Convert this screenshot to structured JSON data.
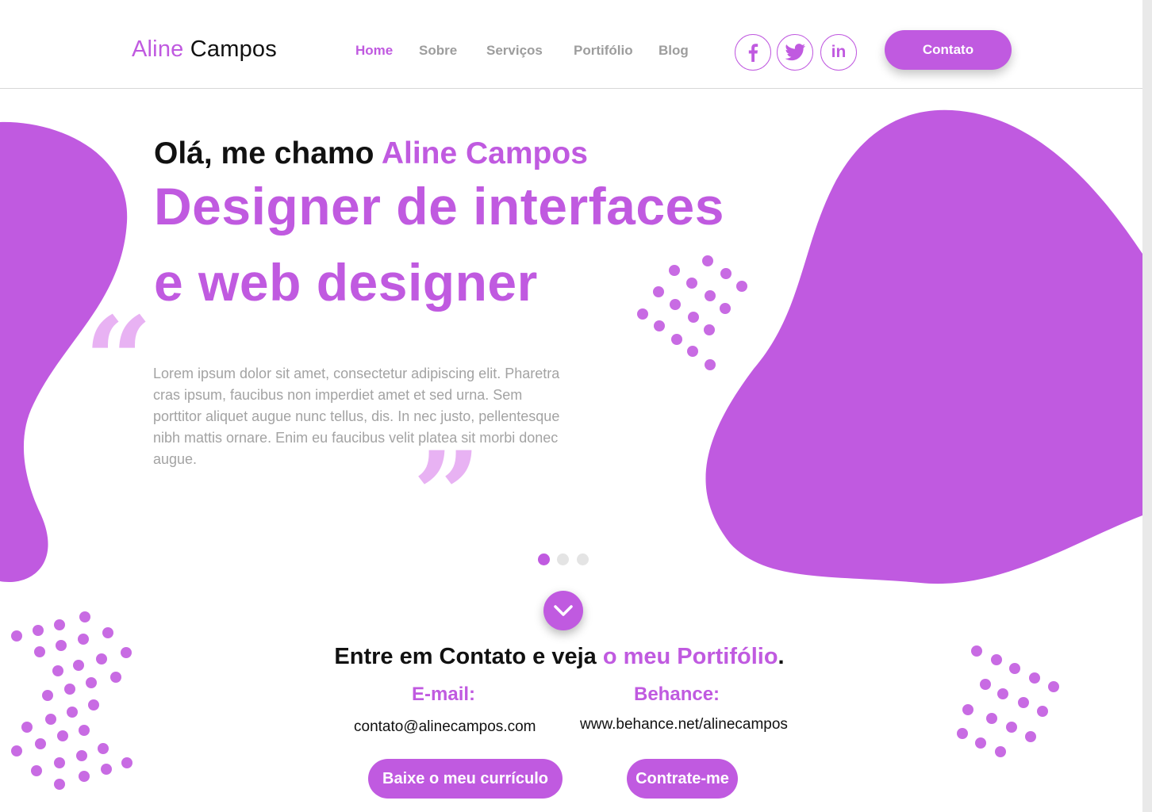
{
  "header": {
    "logo_first": "Aline",
    "logo_last": "Campos",
    "nav": [
      "Home",
      "Sobre",
      "Serviços",
      "Portifólio",
      "Blog"
    ],
    "active_nav": "Home",
    "social_icons": [
      "facebook-icon",
      "twitter-icon",
      "linkedin-icon"
    ],
    "linkedin_glyph": "in",
    "contact_button": "Contato"
  },
  "hero": {
    "greeting_prefix": "Olá, me chamo ",
    "greeting_name": "Aline Campos",
    "title_line1": "Designer de interfaces",
    "title_line2": "e web designer",
    "quote_text": "Lorem ipsum dolor sit amet, consectetur adipiscing elit. Pharetra cras ipsum, faucibus non imperdiet amet et sed urna. Sem porttitor aliquet augue nunc tellus, dis. In nec justo, pellentesque nibh mattis ornare. Enim eu faucibus velit platea sit morbi donec augue.",
    "quote_open": "“",
    "quote_close": "”",
    "slider_total": 3,
    "slider_active": 1
  },
  "contact": {
    "title_prefix": "Entre em Contato e veja ",
    "title_highlight": "o meu Portifólio",
    "title_suffix": ".",
    "email_label": "E-mail:",
    "email_value": "contato@alinecampos.com",
    "behance_label": "Behance:",
    "behance_value": "www.behance.net/alinecampos",
    "download_button": "Baixe o meu currículo",
    "hire_button": "Contrate-me"
  },
  "colors": {
    "accent": "#c05ae0",
    "accent_light": "#e8b2f3",
    "dots": "#c86be3",
    "muted_text": "#a3a3a3",
    "nav_inactive": "#9d9d9d"
  }
}
